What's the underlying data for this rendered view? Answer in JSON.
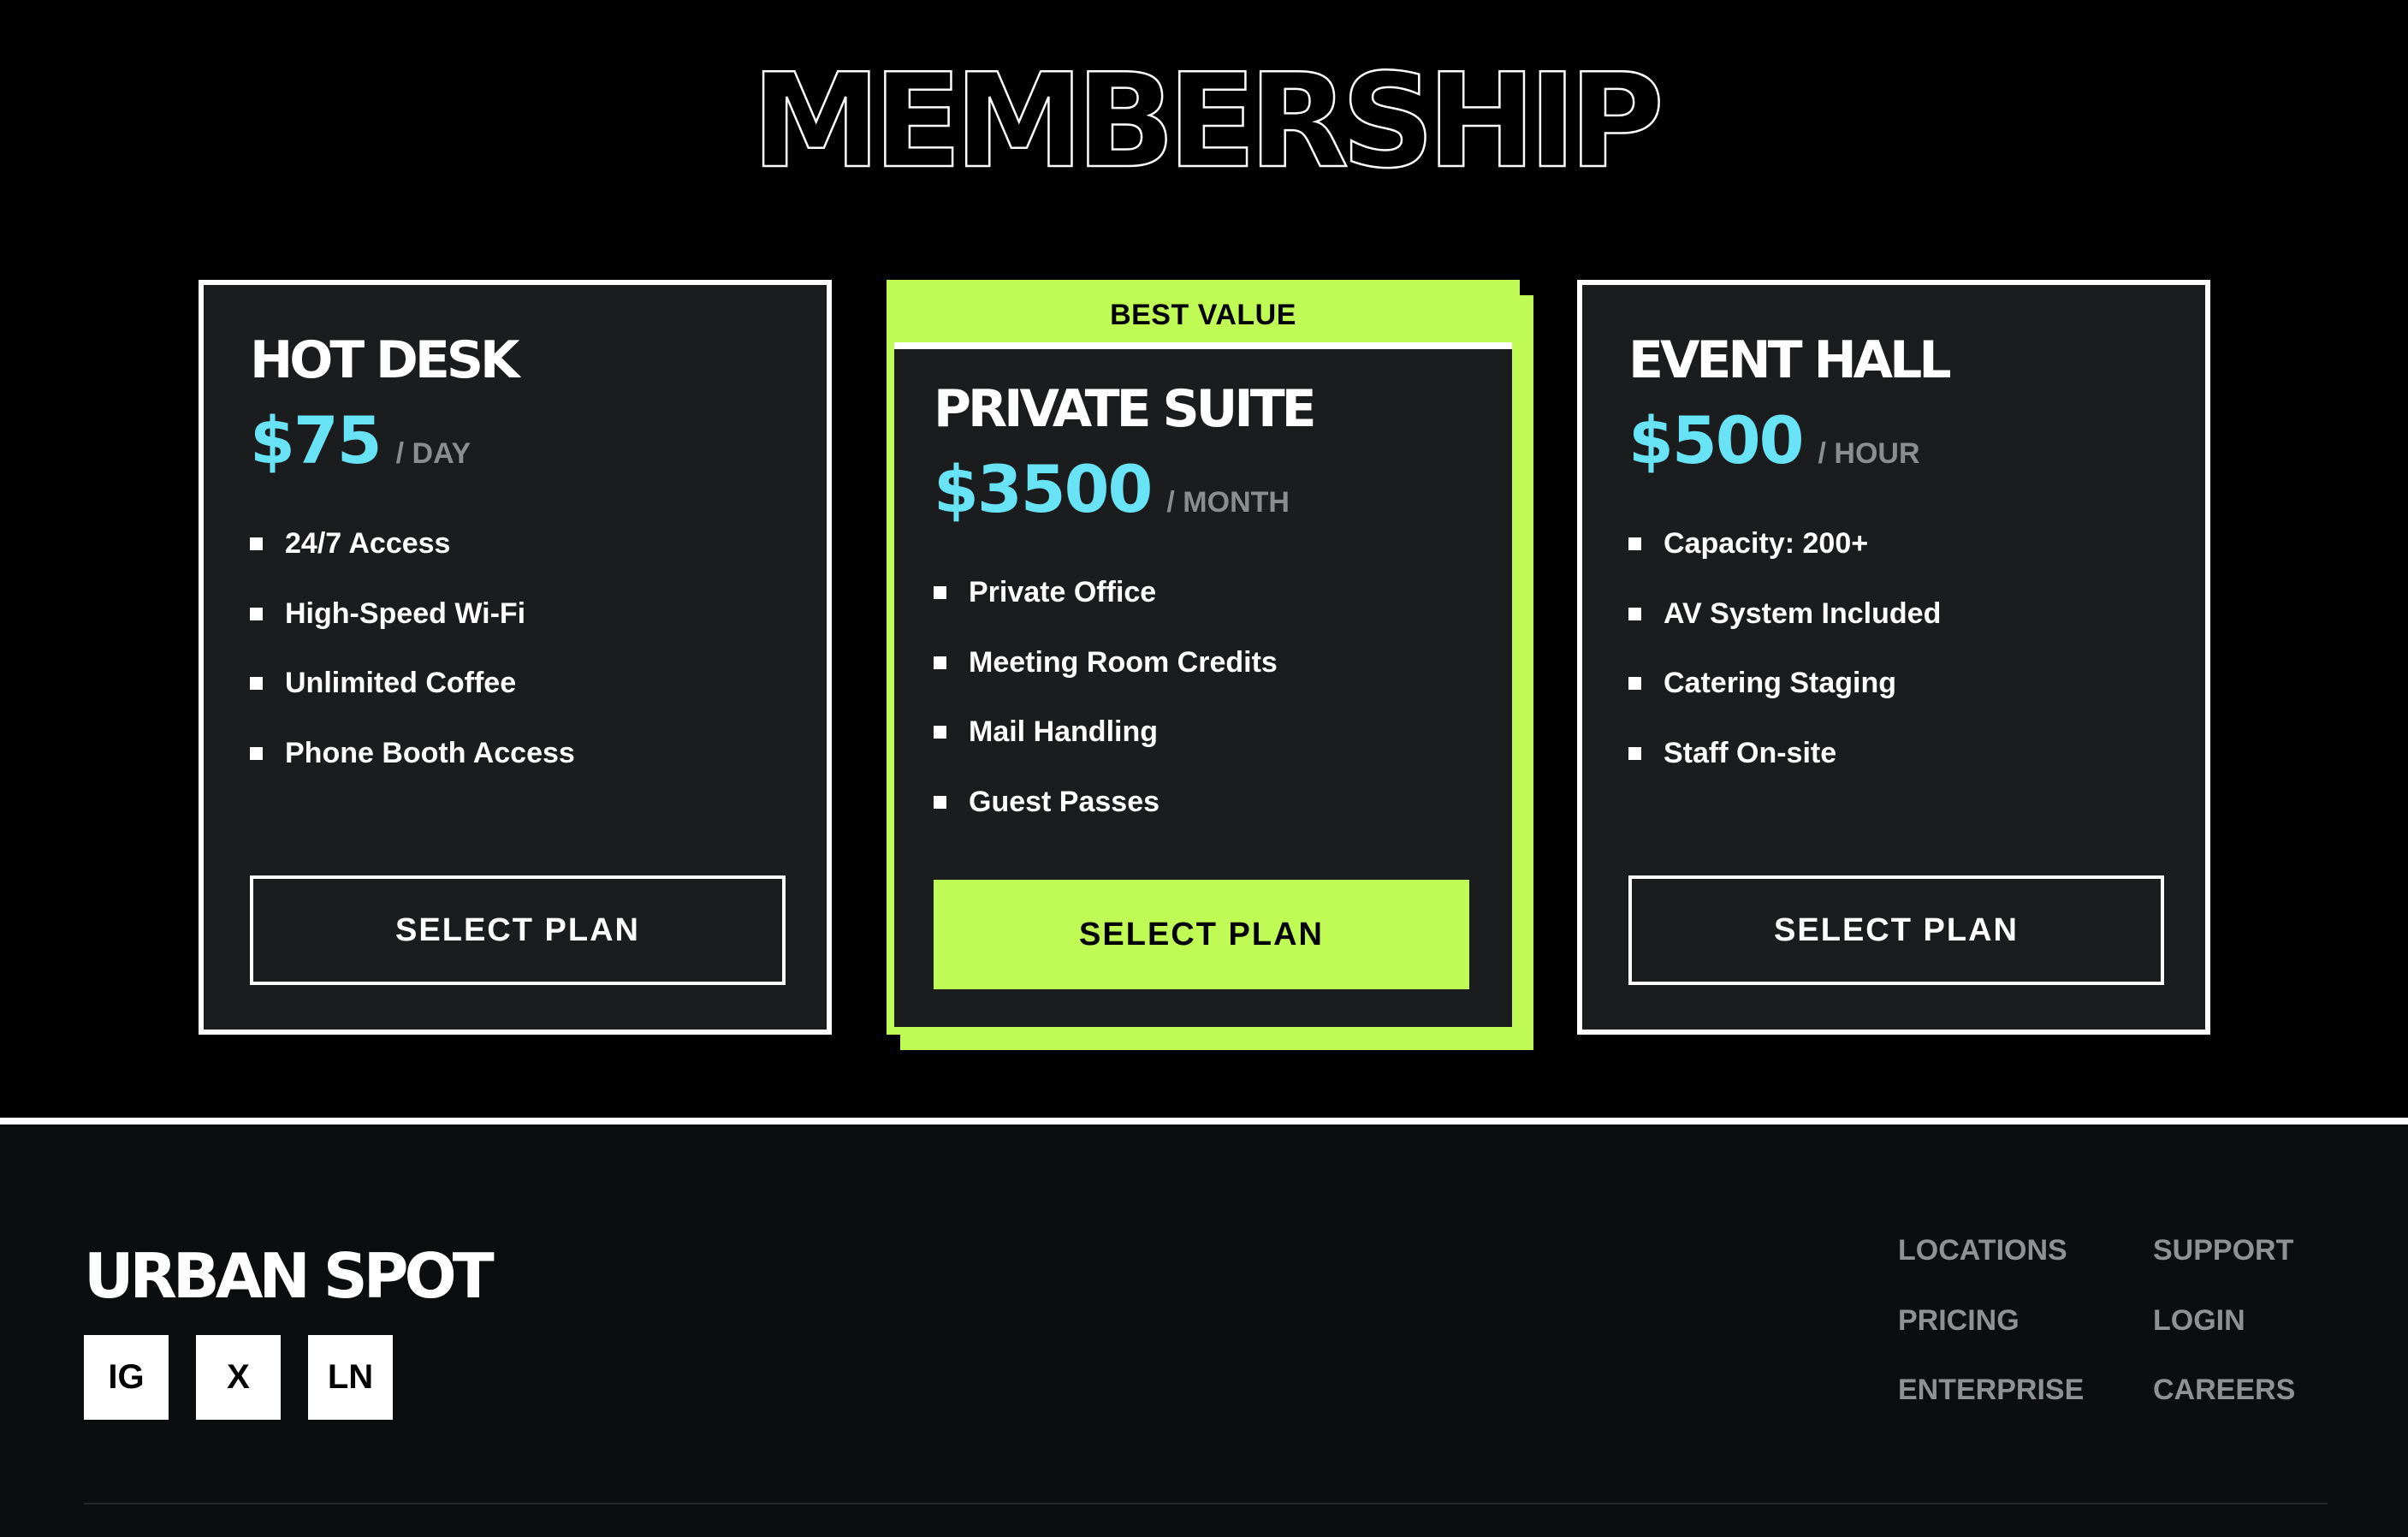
{
  "hero": {
    "title": "MEMBERSHIP"
  },
  "plans": [
    {
      "name": "HOT DESK",
      "price": "$75",
      "period": "/ DAY",
      "features": [
        "24/7 Access",
        "High-Speed Wi-Fi",
        "Unlimited Coffee",
        "Phone Booth Access"
      ],
      "button": "SELECT PLAN"
    },
    {
      "badge": "BEST VALUE",
      "name": "PRIVATE SUITE",
      "price": "$3500",
      "period": "/ MONTH",
      "features": [
        "Private Office",
        "Meeting Room Credits",
        "Mail Handling",
        "Guest Passes"
      ],
      "button": "SELECT PLAN"
    },
    {
      "name": "EVENT HALL",
      "price": "$500",
      "period": "/ HOUR",
      "features": [
        "Capacity: 200+",
        "AV System Included",
        "Catering Staging",
        "Staff On-site"
      ],
      "button": "SELECT PLAN"
    }
  ],
  "footer": {
    "brand": "URBAN SPOT",
    "socials": [
      "IG",
      "X",
      "LN"
    ],
    "links": [
      "LOCATIONS",
      "SUPPORT",
      "PRICING",
      "LOGIN",
      "ENTERPRISE",
      "CAREERS"
    ]
  },
  "colors": {
    "accent": "#c0fa55",
    "price": "#67e3f5",
    "card_bg": "#1b1c1e",
    "footer_bg": "#0c0d0f"
  }
}
